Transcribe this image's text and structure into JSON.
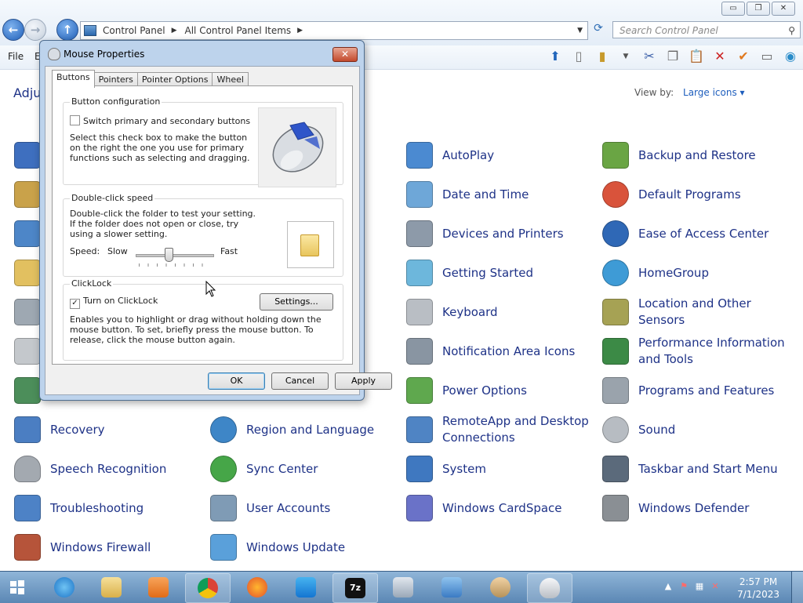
{
  "window": {
    "controls": {
      "minimize": "▭",
      "restore": "❐",
      "close": "✕"
    },
    "breadcrumbs": [
      "Control Panel",
      "All Control Panel Items"
    ],
    "search_placeholder": "Search Control Panel",
    "menu": [
      "File",
      "E"
    ]
  },
  "header": {
    "adjust_text": "Adju",
    "view_by_label": "View by:",
    "view_by_value": "Large icons"
  },
  "items": {
    "col3": [
      {
        "label": "AutoPlay",
        "color": "#4b8ad1"
      },
      {
        "label": "Date and Time",
        "color": "#6ea7d8"
      },
      {
        "label": "Devices and Printers",
        "color": "#8d9aa9"
      },
      {
        "label": "Getting Started",
        "color": "#6db7dc"
      },
      {
        "label": "Keyboard",
        "color": "#b9bec4"
      },
      {
        "label": "Notification Area Icons",
        "color": "#8995a2"
      },
      {
        "label": "Power Options",
        "color": "#5fa84e"
      },
      {
        "label": "RemoteApp and Desktop Connections",
        "color": "#4f84c4"
      },
      {
        "label": "System",
        "color": "#3f78c0"
      },
      {
        "label": "Windows CardSpace",
        "color": "#6a72c8"
      }
    ],
    "col4": [
      {
        "label": "Backup and Restore",
        "color": "#6aa544"
      },
      {
        "label": "Default Programs",
        "color": "#d9533b"
      },
      {
        "label": "Ease of Access Center",
        "color": "#2f68b6"
      },
      {
        "label": "HomeGroup",
        "color": "#3e9bd6"
      },
      {
        "label": "Location and Other Sensors",
        "color": "#a6a254"
      },
      {
        "label": "Performance Information and Tools",
        "color": "#3c8a46"
      },
      {
        "label": "Programs and Features",
        "color": "#9aa3ac"
      },
      {
        "label": "Sound",
        "color": "#b7bcc2"
      },
      {
        "label": "Taskbar and Start Menu",
        "color": "#5b6a7b"
      },
      {
        "label": "Windows Defender",
        "color": "#8a8f94"
      }
    ],
    "bottom_left": [
      {
        "label": "Recovery",
        "color": "#4b7ec2"
      },
      {
        "label": "Speech Recognition",
        "color": "#a3a9b0"
      },
      {
        "label": "Troubleshooting",
        "color": "#4d82c6"
      },
      {
        "label": "Windows Firewall",
        "color": "#b6543a"
      }
    ],
    "bottom_mid": [
      {
        "label": "Region and Language",
        "color": "#3e86c7"
      },
      {
        "label": "Sync Center",
        "color": "#46a648"
      },
      {
        "label": "User Accounts",
        "color": "#7f9bb5"
      },
      {
        "label": "Windows Update",
        "color": "#5aa0da"
      }
    ]
  },
  "dialog": {
    "title": "Mouse Properties",
    "tabs": [
      "Buttons",
      "Pointers",
      "Pointer Options",
      "Wheel"
    ],
    "button_config": {
      "title": "Button configuration",
      "checkbox_label": "Switch primary and secondary buttons",
      "checked": false,
      "description": "Select this check box to make the button on the right the one you use for primary functions such as selecting and dragging."
    },
    "double_click": {
      "title": "Double-click speed",
      "description": "Double-click the folder to test your setting. If the folder does not open or close, try using a slower setting.",
      "speed_label": "Speed:",
      "slow": "Slow",
      "fast": "Fast",
      "speed_value": 0.42
    },
    "clicklock": {
      "title": "ClickLock",
      "checkbox_label": "Turn on ClickLock",
      "checked": true,
      "settings_button": "Settings...",
      "description": "Enables you to highlight or drag without holding down the mouse button. To set, briefly press the mouse button. To release, click the mouse button again."
    },
    "buttons": {
      "ok": "OK",
      "cancel": "Cancel",
      "apply": "Apply"
    }
  },
  "taskbar": {
    "clock_time": "2:57 PM",
    "clock_date": "7/1/2023"
  }
}
